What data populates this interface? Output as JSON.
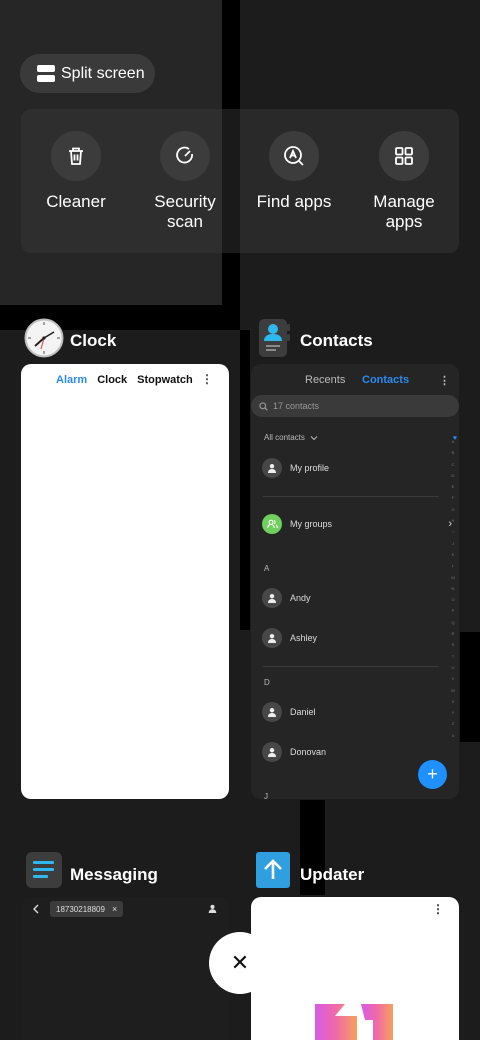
{
  "split_screen": {
    "label": "Split screen"
  },
  "quick_actions": [
    {
      "label_1": "Cleaner",
      "label_2": "",
      "icon": "trash-icon"
    },
    {
      "label_1": "Security",
      "label_2": "scan",
      "icon": "shield-scan-icon"
    },
    {
      "label_1": "Find apps",
      "label_2": "",
      "icon": "search-apps-icon"
    },
    {
      "label_1": "Manage",
      "label_2": "apps",
      "icon": "grid-icon"
    }
  ],
  "apps": {
    "clock": {
      "title": "Clock",
      "tabs": [
        "Alarm",
        "Clock",
        "Stopwatch"
      ],
      "more": "⋮"
    },
    "contacts": {
      "title": "Contacts",
      "tabs": [
        "Recents",
        "Contacts"
      ],
      "more": "⋮",
      "search_placeholder": "17 contacts",
      "filter": "All contacts",
      "my_profile": "My profile",
      "my_groups": "My groups",
      "sections": [
        {
          "letter": "A",
          "names": [
            "Andy",
            "Ashley"
          ]
        },
        {
          "letter": "D",
          "names": [
            "Daniel",
            "Donovan"
          ]
        }
      ],
      "next_letter": "J",
      "index_letters": [
        "A",
        "B",
        "C",
        "D",
        "E",
        "F",
        "G",
        "H",
        "I",
        "J",
        "K",
        "L",
        "M",
        "N",
        "O",
        "P",
        "Q",
        "R",
        "S",
        "T",
        "U",
        "V",
        "W",
        "X",
        "Y",
        "Z",
        "#"
      ],
      "fab": "+"
    },
    "messaging": {
      "title": "Messaging",
      "recipient": "18730218809",
      "chip_close": "×"
    },
    "updater": {
      "title": "Updater",
      "more": "⋮"
    }
  },
  "close_button": {
    "glyph": "✕"
  },
  "colors": {
    "accent_blue": "#2a8cf0",
    "fab_blue": "#1e90ff",
    "groups_green": "#6fcf5f",
    "updater_blue": "#2f9fe0"
  }
}
